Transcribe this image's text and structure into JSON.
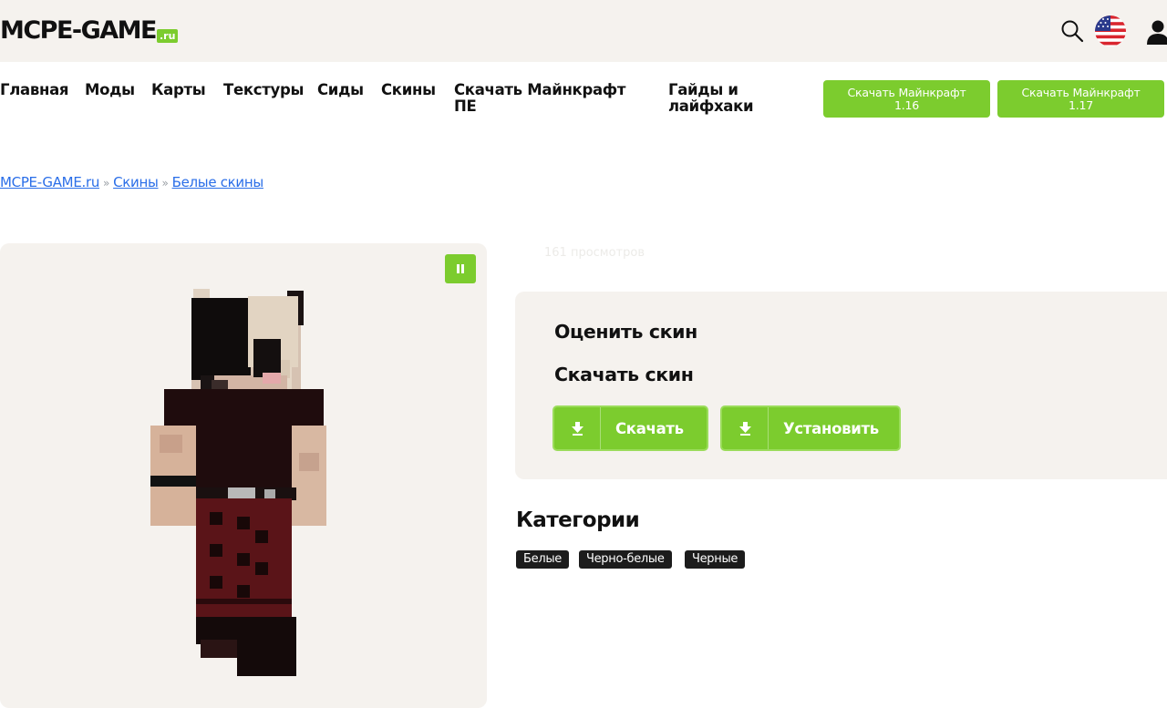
{
  "header": {
    "logo_text": "MCPE-GAME",
    "logo_suffix": ".ru",
    "icons": [
      "search-icon",
      "us-flag-icon",
      "user-icon"
    ]
  },
  "nav": {
    "items": [
      {
        "label": "Главная"
      },
      {
        "label": "Моды"
      },
      {
        "label": "Карты"
      },
      {
        "label": "Текстуры"
      },
      {
        "label": "Сиды"
      },
      {
        "label": "Скины"
      },
      {
        "line1": "Скачать Майнкрафт",
        "line2": "ПЕ"
      },
      {
        "line1": "Гайды и",
        "line2": "лайфхаки"
      }
    ],
    "buttons": [
      {
        "line1": "Скачать Майнкрафт",
        "line2": "1.16"
      },
      {
        "line1": "Скачать Майнкрафт",
        "line2": "1.17"
      }
    ]
  },
  "breadcrumb": {
    "items": [
      "MCPE-GAME.ru",
      "Скины",
      "Белые скины"
    ],
    "separator": "»"
  },
  "viewer": {
    "pause_icon": "pause-icon"
  },
  "info": {
    "views": "161 просмотров",
    "rate_title": "Оценить скин",
    "download_title": "Скачать скин",
    "download_button": "Скачать",
    "install_button": "Установить"
  },
  "categories": {
    "title": "Категории",
    "tags": [
      "Белые",
      "Черно-белые",
      "Черные"
    ]
  },
  "colors": {
    "accent": "#7ccc2e",
    "header_bg": "#f5f2ee",
    "link": "#2a6ee8",
    "tag_bg": "#1c1c1c"
  }
}
